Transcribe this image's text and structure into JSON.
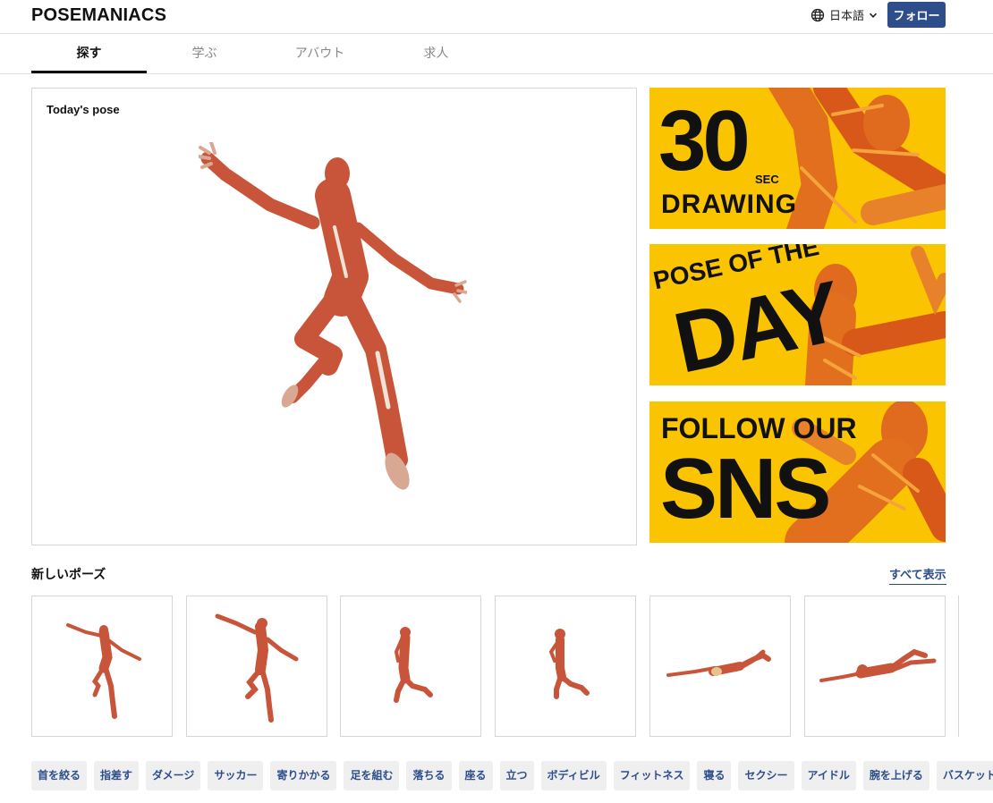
{
  "header": {
    "logo": "POSEMANIACS",
    "language": "日本語",
    "follow_label": "フォロー"
  },
  "tabs": [
    {
      "label": "探す",
      "active": true
    },
    {
      "label": "学ぶ",
      "active": false
    },
    {
      "label": "アバウト",
      "active": false
    },
    {
      "label": "求人",
      "active": false
    }
  ],
  "today": {
    "title": "Today's pose"
  },
  "banners": [
    {
      "line1": "30",
      "line1_suffix": "SEC",
      "line2": "DRAWING"
    },
    {
      "line1": "POSE OF THE",
      "line2": "DAY"
    },
    {
      "line1": "FOLLOW OUR",
      "line2": "SNS"
    }
  ],
  "new_poses": {
    "title": "新しいポーズ",
    "see_all_label": "すべて表示",
    "thumbs": [
      "leaping-pose",
      "leaping-pose-wide",
      "kneeling-jump-pose",
      "kneeling-jump-pose-side",
      "lying-pose",
      "lying-pose-back"
    ]
  },
  "tags": [
    "首を絞る",
    "指差す",
    "ダメージ",
    "サッカー",
    "寄りかかる",
    "足を組む",
    "落ちる",
    "座る",
    "立つ",
    "ボディビル",
    "フィットネス",
    "寝る",
    "セクシー",
    "アイドル",
    "腕を上げる",
    "バスケットボール"
  ],
  "colors": {
    "accent": "#2d4e8a",
    "banner_bg": "#fbc400",
    "muscle": "#c8553a",
    "tendon": "#f0e2d4"
  }
}
